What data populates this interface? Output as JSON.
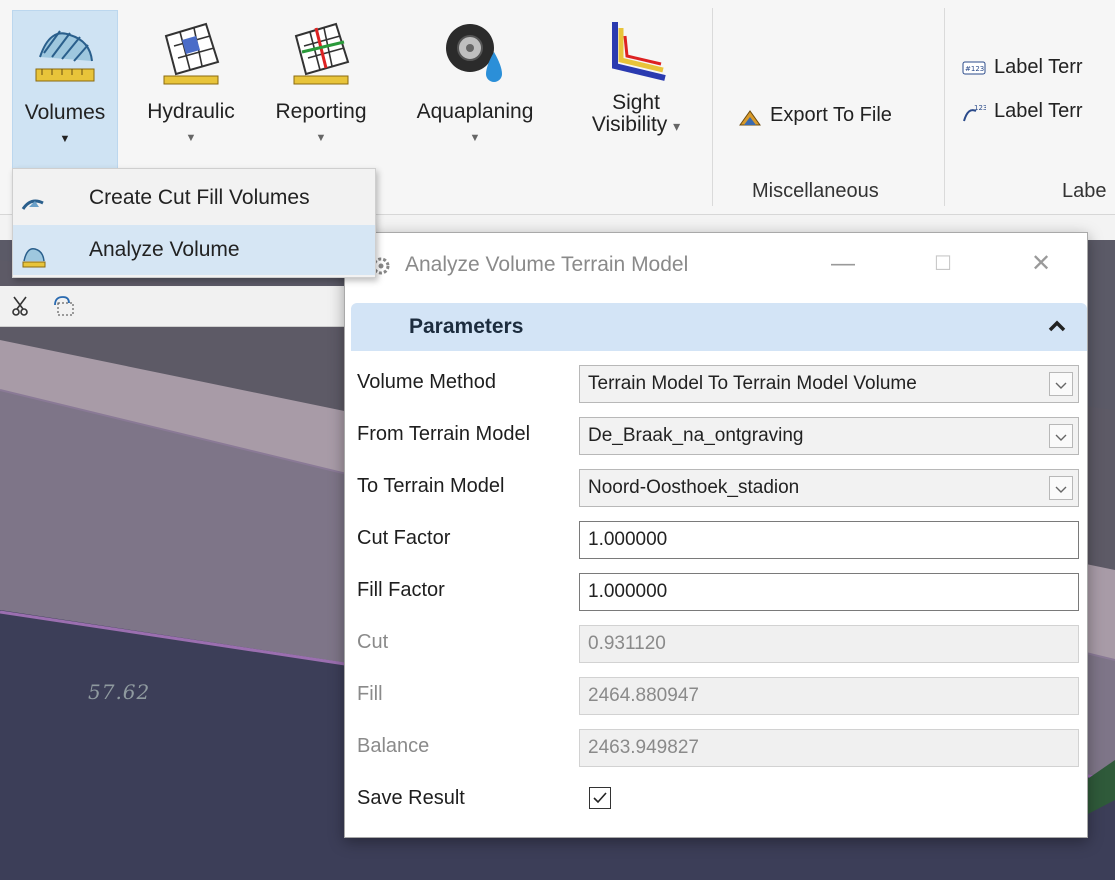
{
  "ribbon": {
    "buttons": [
      {
        "label": "Volumes",
        "caret": "▼"
      },
      {
        "label": "Hydraulic",
        "caret": "▼"
      },
      {
        "label": "Reporting",
        "caret": "▼"
      },
      {
        "label": "Aquaplaning",
        "caret": "▼"
      },
      {
        "label_line1": "Sight",
        "label_line2": "Visibility",
        "caret": "▾"
      }
    ],
    "export_label": "Export To File",
    "misc_group": "Miscellaneous",
    "label_terr_1": "Label Terr",
    "label_terr_2": "Label Terr",
    "labe_group": "Labe"
  },
  "volumes_menu": {
    "items": [
      {
        "label": "Create Cut Fill Volumes"
      },
      {
        "label": "Analyze Volume"
      }
    ]
  },
  "dialog": {
    "title": "Analyze Volume Terrain Model",
    "minimize": "—",
    "maximize": "☐",
    "close": "✕",
    "section_title": "Parameters",
    "rows": [
      {
        "label": "Volume Method",
        "value": "Terrain Model To Terrain Model Volume"
      },
      {
        "label": "From Terrain Model",
        "value": "De_Braak_na_ontgraving"
      },
      {
        "label": "To Terrain Model",
        "value": "Noord-Oosthoek_stadion"
      },
      {
        "label": "Cut Factor",
        "value": "1.000000"
      },
      {
        "label": "Fill Factor",
        "value": "1.000000"
      },
      {
        "label": "Cut",
        "value": "0.931120"
      },
      {
        "label": "Fill",
        "value": "2464.880947"
      },
      {
        "label": "Balance",
        "value": "2463.949827"
      },
      {
        "label": "Save Result",
        "checked": true
      }
    ]
  },
  "viewport": {
    "annotation": "57.62"
  }
}
